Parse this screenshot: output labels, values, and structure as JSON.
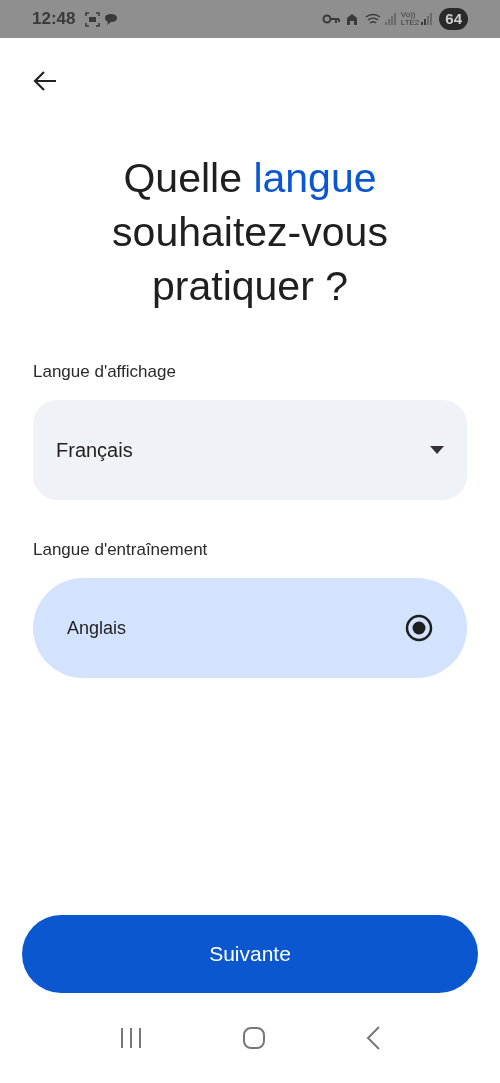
{
  "status_bar": {
    "time": "12:48",
    "network_label": [
      "Vo))",
      "LTE2"
    ],
    "battery": "64"
  },
  "title": [
    {
      "text": "Quelle ",
      "highlight": false
    },
    {
      "text": "langue",
      "highlight": true
    },
    {
      "text": " souhaitez-vous pratiquer ?",
      "highlight": false
    }
  ],
  "display_language": {
    "label": "Langue d'affichage",
    "value": "Français"
  },
  "training_language": {
    "label": "Langue d'entraînement",
    "options": [
      {
        "label": "Anglais",
        "selected": true
      }
    ]
  },
  "next_button": "Suivante"
}
